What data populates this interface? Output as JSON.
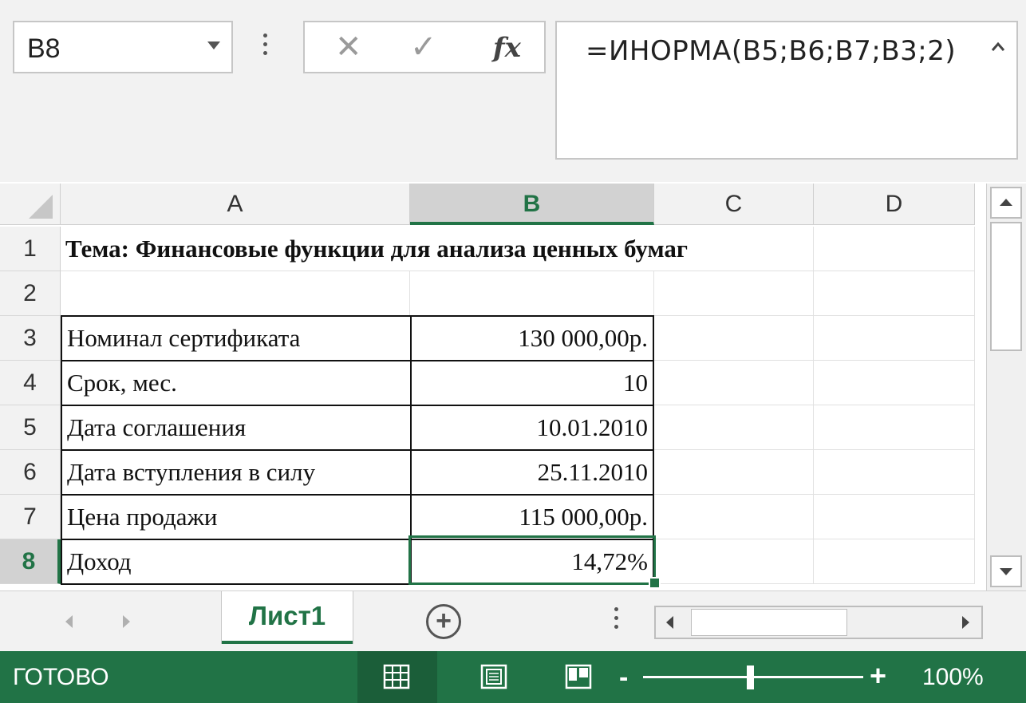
{
  "name_box": {
    "value": "B8"
  },
  "formula_bar": {
    "cancel_glyph": "✕",
    "enter_glyph": "✓",
    "fx_label": "fx",
    "formula": "=ИНОРМА(B5;B6;B7;B3;2)"
  },
  "columns": [
    "A",
    "B",
    "C",
    "D"
  ],
  "rows": [
    "1",
    "2",
    "3",
    "4",
    "5",
    "6",
    "7",
    "8"
  ],
  "cells": {
    "A1": "Тема: Финансовые функции для анализа ценных бумаг",
    "A3": "Номинал сертификата",
    "B3": "130 000,00р.",
    "A4": "Срок, мес.",
    "B4": "10",
    "A5": "Дата соглашения",
    "B5": "10.01.2010",
    "A6": "Дата вступления в силу",
    "B6": "25.11.2010",
    "A7": "Цена продажи",
    "B7": "115 000,00р.",
    "A8": "Доход",
    "B8": "14,72%"
  },
  "active_cell": "B8",
  "sheet_tabs": [
    {
      "label": "Лист1",
      "active": true
    }
  ],
  "add_sheet_glyph": "+",
  "status_bar": {
    "status": "ГОТОВО",
    "zoom_minus": "-",
    "zoom_plus": "+",
    "zoom_level": "100%"
  },
  "colors": {
    "accent": "#217346"
  },
  "icons": [
    "name-box-dropdown-icon",
    "cancel-icon",
    "enter-icon",
    "insert-function-icon",
    "collapse-formula-bar-icon",
    "select-all-icon",
    "scroll-up-icon",
    "scroll-down-icon",
    "sheet-prev-icon",
    "sheet-next-icon",
    "add-sheet-icon",
    "scroll-left-icon",
    "scroll-right-icon",
    "normal-view-icon",
    "page-layout-view-icon",
    "page-break-view-icon"
  ]
}
